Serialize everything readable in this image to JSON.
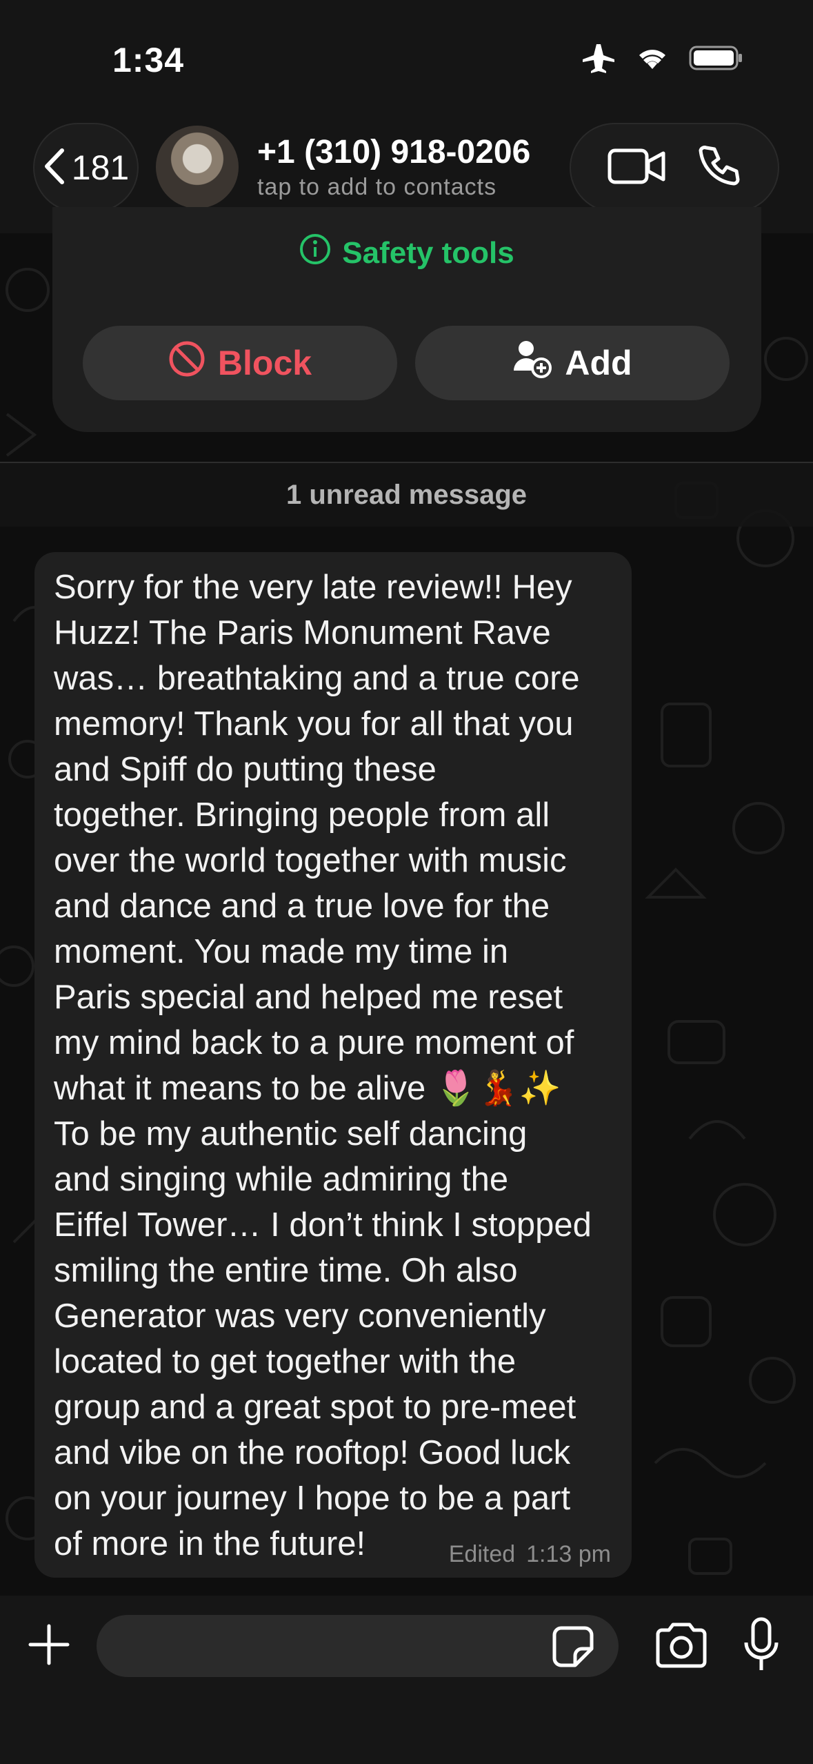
{
  "status_bar": {
    "time": "1:34",
    "icons": [
      "airplane-icon",
      "wifi-icon",
      "battery-icon"
    ]
  },
  "header": {
    "back_count": "181",
    "contact_number": "+1 (310) 918-0206",
    "contact_subtitle": "tap to add to contacts",
    "actions": [
      "video-call-icon",
      "voice-call-icon"
    ]
  },
  "safety_card": {
    "safety_label": "Safety tools",
    "block_label": "Block",
    "add_label": "Add"
  },
  "divider": {
    "unread_label": "1 unread message"
  },
  "message": {
    "text": "Sorry for the very late review!! Hey\nHuzz! The Paris Monument Rave\nwas… breathtaking and a true core\nmemory! Thank you for all that you\nand Spiff do putting these\ntogether. Bringing people from all\nover the world together with music\nand dance and a true love for the\nmoment. You made my time in\nParis special and helped me reset\nmy mind back to a pure moment of\nwhat it means to be alive 🌷💃✨\nTo be my authentic self dancing\nand singing while admiring the\nEiffel Tower… I don’t think I stopped\nsmiling the entire time. Oh also\nGenerator was very conveniently\nlocated to get together with the\ngroup and a great spot to pre-meet\nand vibe on the rooftop! Good luck\non your journey I hope to be a part\nof more in the future!",
    "edited_label": "Edited",
    "time": "1:13 pm"
  },
  "composer": {
    "icons": [
      "plus-icon",
      "sticker-icon",
      "camera-icon",
      "microphone-icon"
    ]
  },
  "colors": {
    "accent_green": "#25c368",
    "danger_red": "#f0535f",
    "bubble": "#202020",
    "background": "#0e0e0e"
  }
}
